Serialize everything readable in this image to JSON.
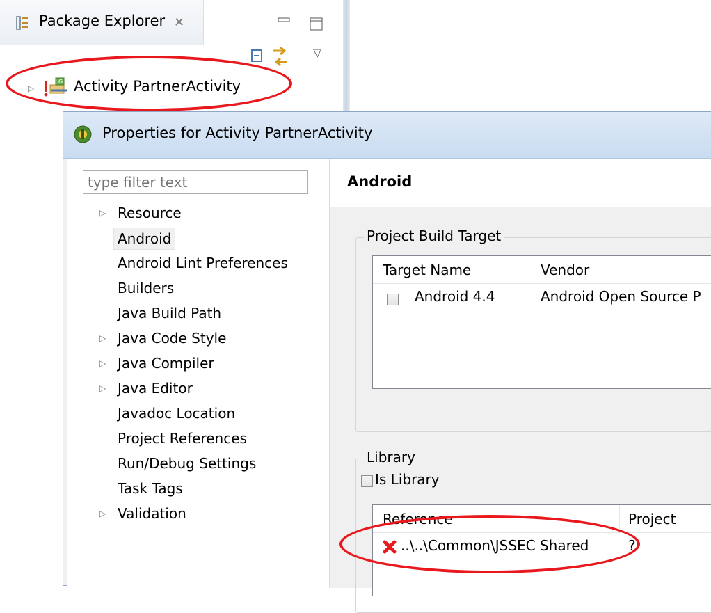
{
  "package_explorer": {
    "tab_label": "Package Explorer",
    "tree_item": "Activity PartnerActivity"
  },
  "dialog": {
    "title": "Properties for Activity PartnerActivity",
    "filter_placeholder": "type filter text",
    "tree": [
      {
        "label": "Resource",
        "expandable": true
      },
      {
        "label": "Android",
        "selected": true
      },
      {
        "label": "Android Lint Preferences"
      },
      {
        "label": "Builders"
      },
      {
        "label": "Java Build Path"
      },
      {
        "label": "Java Code Style",
        "expandable": true
      },
      {
        "label": "Java Compiler",
        "expandable": true
      },
      {
        "label": "Java Editor",
        "expandable": true
      },
      {
        "label": "Javadoc Location"
      },
      {
        "label": "Project References"
      },
      {
        "label": "Run/Debug Settings"
      },
      {
        "label": "Task Tags"
      },
      {
        "label": "Validation",
        "expandable": true
      }
    ],
    "page_title": "Android",
    "build_target": {
      "group_label": "Project Build Target",
      "columns": [
        "Target Name",
        "Vendor"
      ],
      "rows": [
        {
          "target": "Android 4.4",
          "vendor": "Android Open Source P"
        }
      ]
    },
    "library": {
      "group_label": "Library",
      "is_library_label": "Is Library",
      "columns": [
        "Reference",
        "Project"
      ],
      "rows": [
        {
          "reference": "..\\..\\Common\\JSSEC Shared",
          "project": "?"
        }
      ]
    }
  },
  "colors": {
    "highlight_ellipse": "#e8181d",
    "error_icon": "#e8181d",
    "title_bar": "#c9dcf1"
  }
}
